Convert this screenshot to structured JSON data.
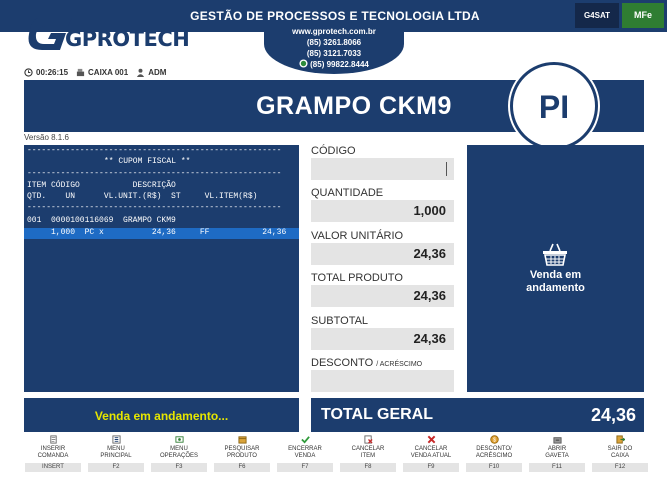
{
  "header": {
    "logo_text": "GPROTECH",
    "company": "GESTÃO DE PROCESSOS E TECNOLOGIA LTDA",
    "website": "www.gprotech.com.br",
    "phone1": "(85) 3261.8066",
    "phone2": "(85) 3121.7033",
    "phone3": "(85) 99822.8444",
    "btn_sat": "G4SAT",
    "btn_mfe": "MFe",
    "colors": {
      "navy": "#1c3d6e",
      "mfe_green": "#2f7d32"
    }
  },
  "status": {
    "time": "00:26:15",
    "register": "CAIXA 001",
    "user": "ADM",
    "version": "Versão 8.1.6"
  },
  "product": {
    "name": "GRAMPO CKM9",
    "badge": "PI"
  },
  "receipt": {
    "divider": "-----------------------------------------------------",
    "title": "** CUPOM FISCAL **",
    "header1": "ITEM CÓDIGO           DESCRIÇÃO",
    "header2": "QTD.    UN      VL.UNIT.(R$)  ST     VL.ITEM(R$)",
    "item_line": "001  0000100116069  GRAMPO CKM9",
    "item_detail": "     1,000  PC x          24,36     FF           24,36"
  },
  "fields": {
    "codigo_label": "CÓDIGO",
    "codigo_value": "",
    "quantidade_label": "QUANTIDADE",
    "quantidade_value": "1,000",
    "valor_unitario_label": "VALOR UNITÁRIO",
    "valor_unitario_value": "24,36",
    "total_produto_label": "TOTAL PRODUTO",
    "total_produto_value": "24,36",
    "subtotal_label": "SUBTOTAL",
    "subtotal_value": "24,36",
    "desconto_label": "DESCONTO",
    "desconto_sub": "/ ACRÉSCIMO",
    "desconto_value": ""
  },
  "sale_panel": {
    "line1": "Venda em",
    "line2": "andamento",
    "icon": "basket-icon"
  },
  "message": "Venda em andamento...",
  "total": {
    "label": "TOTAL GERAL",
    "value": "24,36"
  },
  "functions": [
    {
      "l1": "INSERIR",
      "l2": "COMANDA",
      "key": "INSERT",
      "icon": "comanda-icon"
    },
    {
      "l1": "MENU",
      "l2": "PRINCIPAL",
      "key": "F2",
      "icon": "menu-icon"
    },
    {
      "l1": "MENU",
      "l2": "OPERAÇÕES",
      "key": "F3",
      "icon": "operations-icon"
    },
    {
      "l1": "PESQUISAR",
      "l2": "PRODUTO",
      "key": "F6",
      "icon": "search-product-icon"
    },
    {
      "l1": "ENCERRAR",
      "l2": "VENDA",
      "key": "F7",
      "icon": "check-icon"
    },
    {
      "l1": "CANCELAR",
      "l2": "ITEM",
      "key": "F8",
      "icon": "cancel-item-icon"
    },
    {
      "l1": "CANCELAR",
      "l2": "VENDA ATUAL",
      "key": "F9",
      "icon": "cancel-sale-icon"
    },
    {
      "l1": "DESCONTO/",
      "l2": "ACRÉSCIMO",
      "key": "F10",
      "icon": "discount-icon"
    },
    {
      "l1": "ABRIR",
      "l2": "GAVETA",
      "key": "F11",
      "icon": "drawer-icon"
    },
    {
      "l1": "SAIR DO",
      "l2": "CAIXA",
      "key": "F12",
      "icon": "exit-icon"
    }
  ]
}
